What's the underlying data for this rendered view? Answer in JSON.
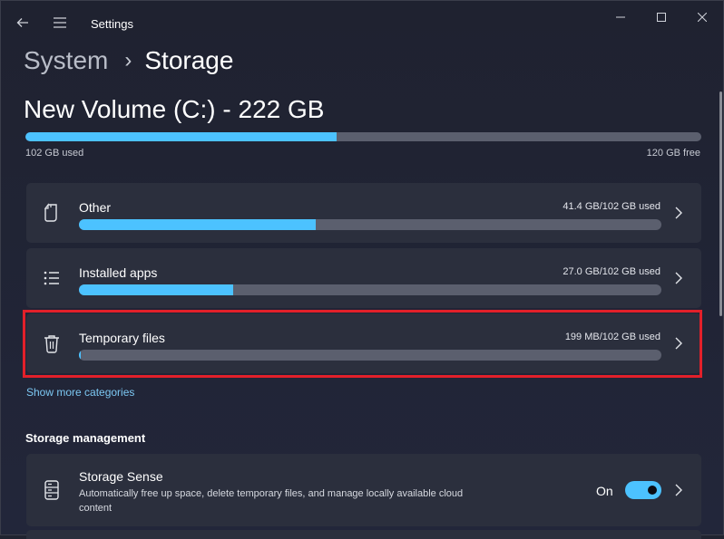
{
  "window": {
    "app_title": "Settings",
    "controls": {
      "minimize_icon": "minimize-icon",
      "maximize_icon": "maximize-icon",
      "close_icon": "close-icon"
    }
  },
  "breadcrumb": {
    "parent": "System",
    "separator": "›",
    "current": "Storage"
  },
  "volume": {
    "title": "New Volume (C:) - 222 GB",
    "used_label": "102 GB used",
    "free_label": "120 GB free",
    "used_fraction": 0.46
  },
  "categories": [
    {
      "label": "Other",
      "usage": "41.4 GB/102 GB used",
      "icon": "document-icon",
      "fraction": 0.406
    },
    {
      "label": "Installed apps",
      "usage": "27.0 GB/102 GB used",
      "icon": "list-icon",
      "fraction": 0.265
    },
    {
      "label": "Temporary files",
      "usage": "199 MB/102 GB used",
      "icon": "trash-icon",
      "fraction": 0.002
    }
  ],
  "show_more": "Show more categories",
  "storage_management": {
    "section_title": "Storage management",
    "sense_title": "Storage Sense",
    "sense_desc": "Automatically free up space, delete temporary files, and manage locally available cloud content",
    "toggle_label": "On",
    "toggle_on": true
  },
  "colors": {
    "accent": "#4cc2ff",
    "highlight": "#e2202a",
    "link": "#7cc8f3"
  }
}
